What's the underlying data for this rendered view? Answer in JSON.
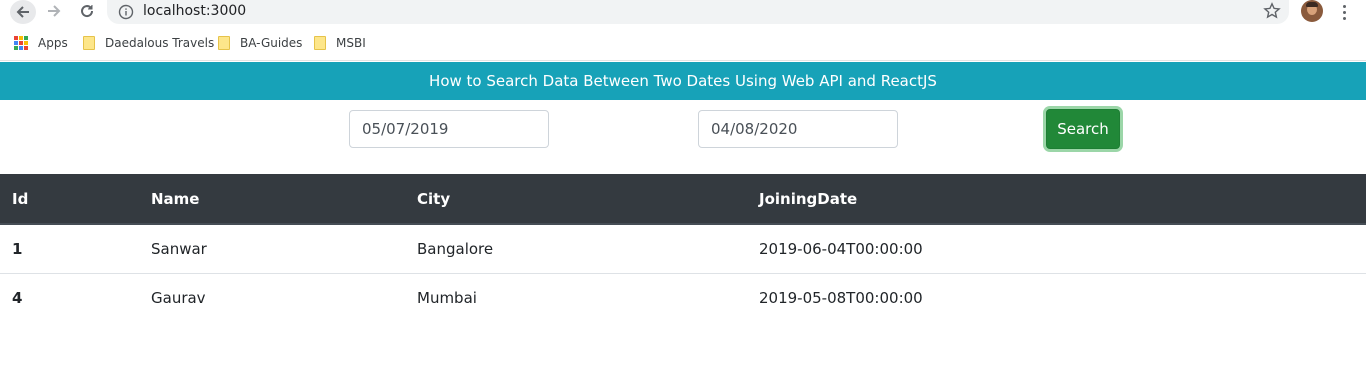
{
  "browser": {
    "url": "localhost:3000",
    "bookmarks": [
      "Apps",
      "Daedalous Travels",
      "BA-Guides",
      "MSBI"
    ]
  },
  "app": {
    "title": "How to Search Data Between Two Dates Using Web API and ReactJS",
    "start_date": "05/07/2019",
    "end_date": "04/08/2020",
    "search_label": "Search"
  },
  "table": {
    "columns": [
      "Id",
      "Name",
      "City",
      "JoiningDate"
    ],
    "rows": [
      {
        "id": "1",
        "name": "Sanwar",
        "city": "Bangalore",
        "joining_date": "2019-06-04T00:00:00"
      },
      {
        "id": "4",
        "name": "Gaurav",
        "city": "Mumbai",
        "joining_date": "2019-05-08T00:00:00"
      }
    ]
  },
  "colors": {
    "banner": "#17a2b8",
    "table_header": "#343a40",
    "search_button": "#218838"
  },
  "icons": [
    "back-arrow-icon",
    "forward-arrow-icon",
    "reload-icon",
    "info-icon",
    "star-icon",
    "apps-grid-icon",
    "folder-icon",
    "more-vert-icon"
  ]
}
